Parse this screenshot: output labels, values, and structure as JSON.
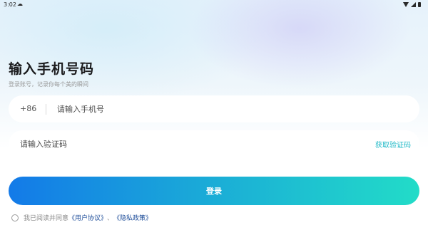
{
  "status_bar": {
    "time": "3:02",
    "app_icon": "cloud-sync-icon",
    "icons": [
      "wifi-icon",
      "signal-icon",
      "battery-icon"
    ]
  },
  "header": {
    "title": "输入手机号码",
    "subtitle": "登录账号，记录你每个美的瞬间"
  },
  "phone": {
    "prefix": "+86",
    "placeholder": "请输入手机号",
    "value": ""
  },
  "code": {
    "placeholder": "请输入验证码",
    "value": "",
    "get_code_label": "获取验证码"
  },
  "login": {
    "label": "登录"
  },
  "agreement": {
    "prefix": "我已阅读并同意",
    "user_agreement": "《用户协议》",
    "separator": "、",
    "privacy_policy": "《隐私政策》",
    "checked": false
  },
  "colors": {
    "accent": "#1fb9c7",
    "button_start": "#137ae8",
    "button_end": "#22dcc8",
    "link": "#1f4e9a"
  }
}
